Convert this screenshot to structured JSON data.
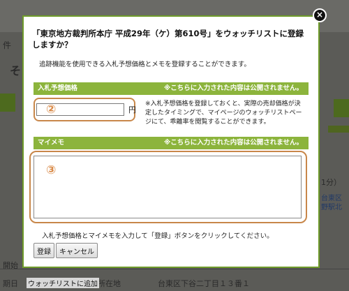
{
  "background": {
    "left_fragment": "件",
    "heading_fragment": "そ",
    "row_left": "期日",
    "row_left_2": "開始",
    "row_mid": "所在地",
    "row_right": "台東区下谷二丁目１３番１",
    "blue_text_1": "台東区",
    "blue_text_2": "野駅北",
    "right_fragment_1": "1分）"
  },
  "modal": {
    "close_symbol": "×",
    "title": "「東京地方裁判所本庁 平成29年（ケ）第610号」をウォッチリストに登録しますか？",
    "description": "追跡機能を使用できる入札予想価格とメモを登録することができます。",
    "budget_section": {
      "label": "入札予想価格",
      "note": "※こちらに入力された内容は公開されません。",
      "number_label": "②",
      "input_value": "",
      "unit": "円",
      "help_text": "※入札予想価格を登録しておくと、実際の売却価格が決定したタイミングで、マイページのウォッチリストページにて、乖離率を閲覧することができます。"
    },
    "memo_section": {
      "label": "マイメモ",
      "note": "※こちらに入力された内容は公開されません。",
      "number_label": "③",
      "input_value": ""
    },
    "instruction": "入札予想価格とマイメモを入力して「登録」ボタンをクリックしてください。",
    "register_button": "登録",
    "cancel_button": "キャンセル"
  },
  "footer_link": "ウォッチリストに追加",
  "colors": {
    "accent_green": "#8cb43c",
    "modal_border": "#6e9b2a",
    "highlight_orange": "#c8874a"
  }
}
